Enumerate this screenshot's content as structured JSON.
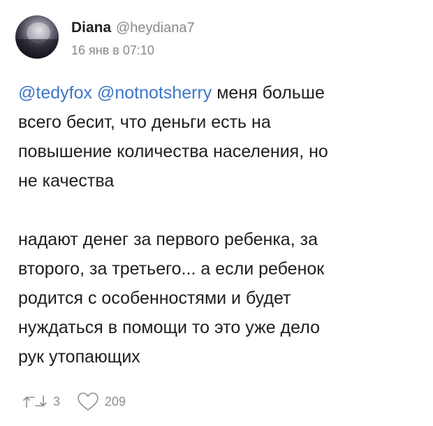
{
  "author": {
    "name": "Diana",
    "handle": "@heydiana7",
    "date": "16 янв в 07:10"
  },
  "tweet": {
    "mentions": [
      "@tedyfox",
      "@notnotsherry"
    ],
    "lines": [
      "меня больше",
      "всего бесит, что деньги есть на",
      "повышение количества населения, но",
      "не качества",
      "надают денег за первого ребенка, за",
      "второго, за третьего... а если ребенок",
      "родится с особенностями и будет",
      "нуждаться в помощи то это уже дело",
      "рук утопающих"
    ]
  },
  "actions": {
    "retweet_icon": "retweet-icon",
    "retweet_count": "3",
    "like_icon": "heart-icon",
    "like_count": "209"
  },
  "colors": {
    "mention": "#3d76c7",
    "muted": "#8a8a8a"
  }
}
